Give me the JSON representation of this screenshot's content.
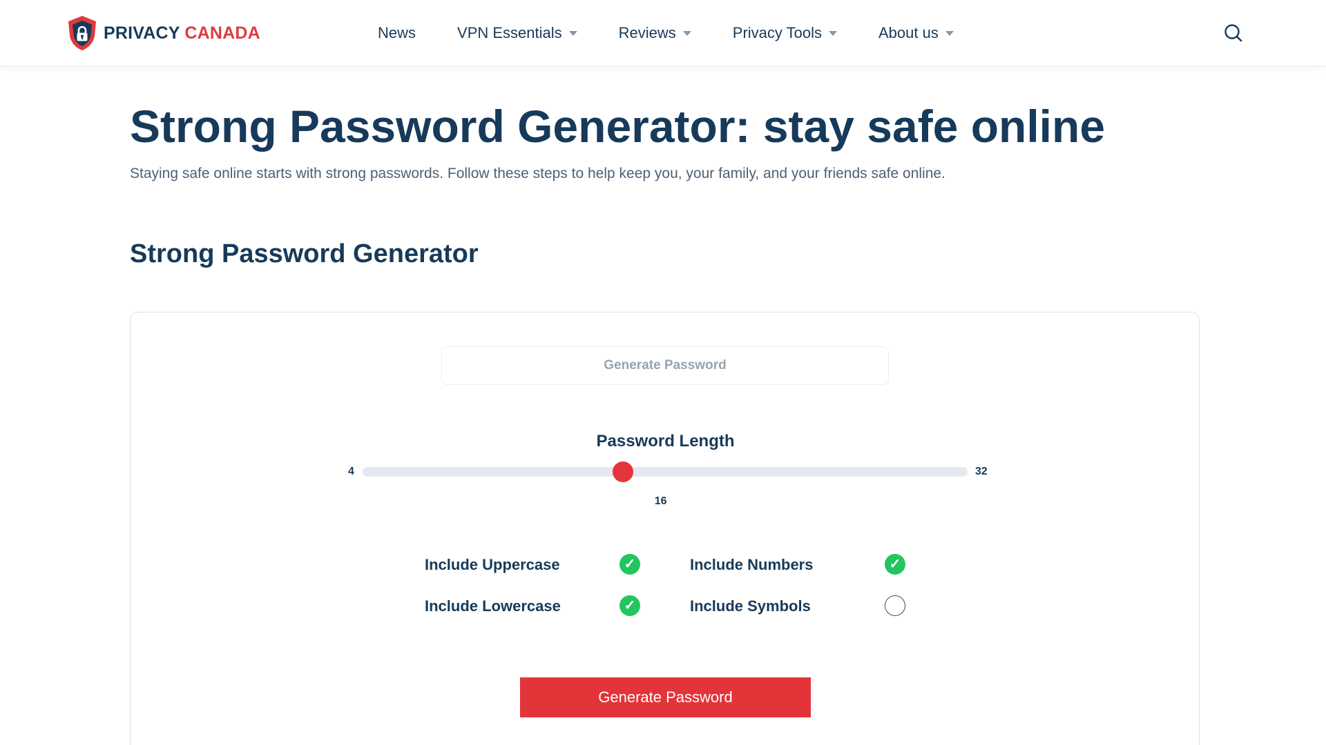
{
  "header": {
    "logo": {
      "word1": "PRIVACY",
      "word2": "CANADA",
      "icon": "shield-lock-icon"
    },
    "nav": [
      {
        "label": "News",
        "dropdown": false
      },
      {
        "label": "VPN Essentials",
        "dropdown": true
      },
      {
        "label": "Reviews",
        "dropdown": true
      },
      {
        "label": "Privacy Tools",
        "dropdown": true
      },
      {
        "label": "About us",
        "dropdown": true
      }
    ],
    "search_icon": "search-icon"
  },
  "page": {
    "title": "Strong Password Generator: stay safe online",
    "subtitle": "Staying safe online starts with strong passwords. Follow these steps to help keep you, your family, and your friends safe online.",
    "section_title": "Strong Password Generator"
  },
  "generator": {
    "output_placeholder": "Generate Password",
    "length_label": "Password Length",
    "length_min": "4",
    "length_max": "32",
    "length_value": "16",
    "length_fraction": 0.43,
    "options": [
      {
        "label": "Include Uppercase",
        "checked": true
      },
      {
        "label": "Include Numbers",
        "checked": true
      },
      {
        "label": "Include Lowercase",
        "checked": true
      },
      {
        "label": "Include Symbols",
        "checked": false
      }
    ],
    "button_label": "Generate Password"
  },
  "colors": {
    "brand_navy": "#173a5a",
    "brand_red": "#e3343a",
    "check_green": "#22c55e"
  }
}
